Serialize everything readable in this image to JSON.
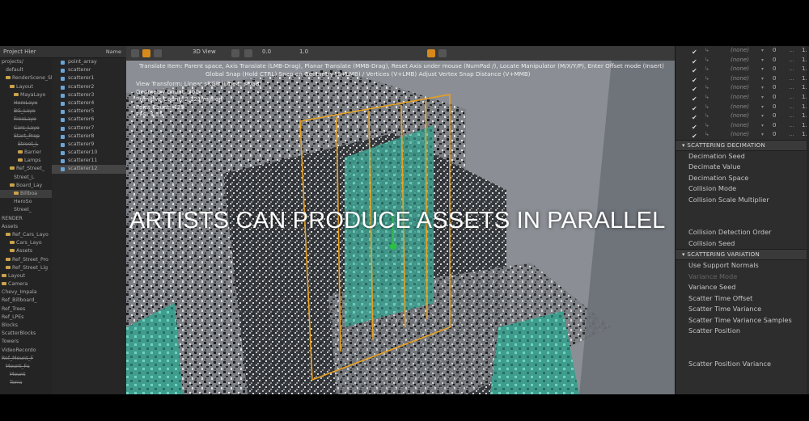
{
  "caption": "ARTISTS CAN PRODUCE ASSETS IN PARALLEL",
  "outliner": {
    "header": "Project Hier",
    "rows": [
      {
        "label": "projects/",
        "indent": 0,
        "folder": false,
        "sel": false,
        "strike": false
      },
      {
        "label": "default",
        "indent": 1,
        "folder": false,
        "sel": false,
        "strike": false
      },
      {
        "label": "RenderScene_Sho",
        "indent": 1,
        "folder": true,
        "sel": false,
        "strike": false
      },
      {
        "label": "Layout",
        "indent": 2,
        "folder": true,
        "sel": false,
        "strike": false
      },
      {
        "label": "MayaLayo",
        "indent": 3,
        "folder": true,
        "sel": false,
        "strike": false
      },
      {
        "label": "HeroLayo",
        "indent": 3,
        "folder": false,
        "sel": false,
        "strike": true
      },
      {
        "label": "BG_Layo",
        "indent": 3,
        "folder": false,
        "sel": false,
        "strike": true
      },
      {
        "label": "FreeLayo",
        "indent": 3,
        "folder": false,
        "sel": false,
        "strike": true
      },
      {
        "label": "Cars_Layo",
        "indent": 3,
        "folder": false,
        "sel": false,
        "strike": true
      },
      {
        "label": "Start_Prep",
        "indent": 3,
        "folder": false,
        "sel": false,
        "strike": true
      },
      {
        "label": "Street_L",
        "indent": 4,
        "folder": false,
        "sel": false,
        "strike": true
      },
      {
        "label": "Barrier",
        "indent": 4,
        "folder": true,
        "sel": false,
        "strike": false
      },
      {
        "label": "Lamps",
        "indent": 4,
        "folder": true,
        "sel": false,
        "strike": false
      },
      {
        "label": "Ref_Street_",
        "indent": 2,
        "folder": true,
        "sel": false,
        "strike": false
      },
      {
        "label": "Street_L",
        "indent": 3,
        "folder": false,
        "sel": false,
        "strike": false
      },
      {
        "label": "Board_Lay",
        "indent": 2,
        "folder": true,
        "sel": false,
        "strike": false
      },
      {
        "label": "Billboa",
        "indent": 3,
        "folder": true,
        "sel": true,
        "strike": false
      },
      {
        "label": "HeroSo",
        "indent": 3,
        "folder": false,
        "sel": false,
        "strike": false
      },
      {
        "label": "Street_",
        "indent": 3,
        "folder": false,
        "sel": false,
        "strike": false
      },
      {
        "label": "RENDER",
        "indent": 0,
        "folder": false,
        "sel": false,
        "strike": false
      },
      {
        "label": "Assets",
        "indent": 0,
        "folder": false,
        "sel": false,
        "strike": false
      },
      {
        "label": "Ref_Cars_Layo",
        "indent": 1,
        "folder": true,
        "sel": false,
        "strike": false
      },
      {
        "label": "Cars_Layo",
        "indent": 2,
        "folder": true,
        "sel": false,
        "strike": false
      },
      {
        "label": "Assets",
        "indent": 2,
        "folder": true,
        "sel": false,
        "strike": false
      },
      {
        "label": "Ref_Street_Pro",
        "indent": 1,
        "folder": true,
        "sel": false,
        "strike": false
      },
      {
        "label": "Ref_Street_Lig",
        "indent": 1,
        "folder": true,
        "sel": false,
        "strike": false
      },
      {
        "label": "Layout",
        "indent": 0,
        "folder": true,
        "sel": false,
        "strike": false
      },
      {
        "label": "Camera",
        "indent": 0,
        "folder": true,
        "sel": false,
        "strike": false
      },
      {
        "label": "Chevy_Impala",
        "indent": 0,
        "folder": false,
        "sel": false,
        "strike": false
      },
      {
        "label": "Ref_Billboard_",
        "indent": 0,
        "folder": false,
        "sel": false,
        "strike": false
      },
      {
        "label": "Ref_Trees",
        "indent": 0,
        "folder": false,
        "sel": false,
        "strike": false
      },
      {
        "label": "Ref_LPEs",
        "indent": 0,
        "folder": false,
        "sel": false,
        "strike": false
      },
      {
        "label": "Blocks",
        "indent": 0,
        "folder": false,
        "sel": false,
        "strike": false
      },
      {
        "label": "ScatterBlocks",
        "indent": 0,
        "folder": false,
        "sel": false,
        "strike": false
      },
      {
        "label": "Towers",
        "indent": 0,
        "folder": false,
        "sel": false,
        "strike": false
      },
      {
        "label": "VideoRecordo",
        "indent": 0,
        "folder": false,
        "sel": false,
        "strike": false
      },
      {
        "label": "Ref_Mount_F",
        "indent": 0,
        "folder": false,
        "sel": false,
        "strike": true
      },
      {
        "label": "Mount_Fu",
        "indent": 1,
        "folder": false,
        "sel": false,
        "strike": true
      },
      {
        "label": "Mount",
        "indent": 2,
        "folder": false,
        "sel": false,
        "strike": true
      },
      {
        "label": "Terra",
        "indent": 2,
        "folder": false,
        "sel": false,
        "strike": true
      }
    ]
  },
  "scatter_panel": {
    "header_name": "Name",
    "rows": [
      "point_array",
      "scatterer",
      "scatterer1",
      "scatterer2",
      "scatterer3",
      "scatterer4",
      "scatterer5",
      "scatterer6",
      "scatterer7",
      "scatterer8",
      "scatterer9",
      "scatterer10",
      "scatterer11",
      "scatterer12"
    ],
    "selected_index": 13
  },
  "viewport": {
    "toolbar_view": "3D View",
    "toolbar_value_a": "0.0",
    "toolbar_value_b": "1.0",
    "hint_line_1": "Translate Item: Parent space, Axis Translate (LMB-Drag), Planar Translate (MMB-Drag), Reset Axis under mouse (NumPad /), Locate Manipulator (M/X/Y/P), Enter Offset mode (Insert)",
    "hint_line_2": "Global Snap (Hold CTRL) Snap on Geometry (S+LMB) / Vertices (V+LMB) Adjust Vertex Snap Distance (V+MMB)",
    "stats": [
      "View Transform: Linear sRGB (Linear sRGB)",
      "Geometry Count: 300",
      "Primitive Count: 2,121 million",
      "Point Count: 429",
      "FPS: 4.55"
    ]
  },
  "attributes": {
    "layer_rows": 10,
    "none_label": "(none)",
    "zero_label": "0",
    "dots_label": "...",
    "one_label": "1.0",
    "sections": [
      {
        "title": "SCATTERING DECIMATION",
        "props": [
          {
            "label": "Decimation Seed",
            "dim": false
          },
          {
            "label": "Decimate Value",
            "dim": false
          },
          {
            "label": "Decimation Space",
            "dim": false
          },
          {
            "label": "Collision Mode",
            "dim": false
          },
          {
            "label": "Collision Scale Multiplier",
            "dim": false
          },
          {
            "label": "",
            "dim": false
          },
          {
            "label": "",
            "dim": false
          },
          {
            "label": "Collision Detection Order",
            "dim": false
          },
          {
            "label": "Collision Seed",
            "dim": false
          }
        ]
      },
      {
        "title": "SCATTERING VARIATION",
        "props": [
          {
            "label": "Use Support Normals",
            "dim": false
          },
          {
            "label": "Variance Mode",
            "dim": true
          },
          {
            "label": "Variance Seed",
            "dim": false
          },
          {
            "label": "Scatter Time Offset",
            "dim": false
          },
          {
            "label": "Scatter Time Variance",
            "dim": false
          },
          {
            "label": "Scatter Time Variance Samples",
            "dim": false
          },
          {
            "label": "Scatter Position",
            "dim": false
          },
          {
            "label": "",
            "dim": false
          },
          {
            "label": "",
            "dim": false
          },
          {
            "label": "Scatter Position Variance",
            "dim": false
          }
        ]
      }
    ]
  },
  "colors": {
    "accent_orange": "#e8a020",
    "scatter_teal": "#4aa89a",
    "selection_blue": "#6aa6d8"
  }
}
